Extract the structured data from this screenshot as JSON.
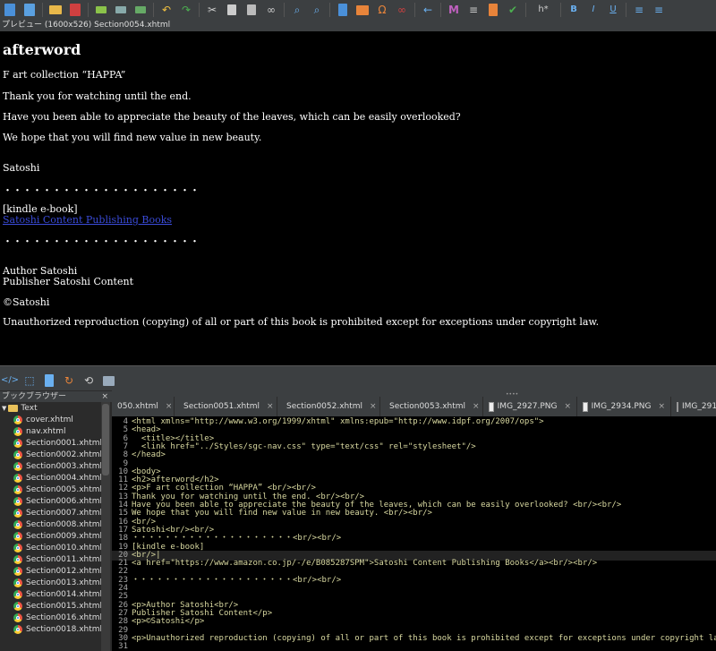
{
  "toolbar": {
    "icons": [
      "new-book-icon",
      "new-file-icon",
      "open-icon",
      "save-icon",
      "add-file-icon",
      "add-existing-icon",
      "import-icon",
      "undo-icon",
      "redo-icon",
      "cut-icon",
      "copy-icon",
      "paste-icon",
      "link-icon",
      "find-icon",
      "find-replace-icon",
      "metadata-icon",
      "image-icon",
      "special-char-icon",
      "link-toggle-icon",
      "previous-icon",
      "spell-icon",
      "list-icon",
      "bookmark-icon",
      "validate-icon",
      "heading-icon",
      "bold-icon",
      "italic-icon",
      "underline-icon",
      "bullet-list-icon",
      "numbered-list-icon"
    ],
    "heading_label": "h*",
    "bold_label": "B",
    "italic_label": "I",
    "underline_label": "U"
  },
  "preview": {
    "title": "プレビュー (1600x526) Section0054.xhtml",
    "heading": "afterword",
    "line1": "F art collection “HAPPA”",
    "line2": "Thank you for watching until the end.",
    "line3": "Have you been able to appreciate the beauty of the leaves, which can be easily overlooked?",
    "line4": "We hope that you will find new value in new beauty.",
    "line5": "Satoshi",
    "dots1": "・・・・・・・・・・・・・・・・・・・・",
    "kindle": "[kindle e-book]",
    "link": "Satoshi Content Publishing Books",
    "dots2": "・・・・・・・・・・・・・・・・・・・・",
    "author": "Author Satoshi",
    "publisher": "Publisher Satoshi Content",
    "copyright": "©Satoshi",
    "notice": "Unauthorized reproduction (copying) of all or part of this book is prohibited except for exceptions under copyright law."
  },
  "book_browser": {
    "title": "ブックブラウザー",
    "close": "×",
    "folder": "Text",
    "files": [
      "cover.xhtml",
      "nav.xhtml",
      "Section0001.xhtml",
      "Section0002.xhtml",
      "Section0003.xhtml",
      "Section0004.xhtml",
      "Section0005.xhtml",
      "Section0006.xhtml",
      "Section0007.xhtml",
      "Section0008.xhtml",
      "Section0009.xhtml",
      "Section0010.xhtml",
      "Section0011.xhtml",
      "Section0012.xhtml",
      "Section0013.xhtml",
      "Section0014.xhtml",
      "Section0015.xhtml",
      "Section0016.xhtml",
      "Section0018.xhtml"
    ]
  },
  "tabs": [
    {
      "label": "050.xhtml",
      "type": "xhtml"
    },
    {
      "label": "Section0051.xhtml",
      "type": "xhtml"
    },
    {
      "label": "Section0052.xhtml",
      "type": "xhtml"
    },
    {
      "label": "Section0053.xhtml",
      "type": "xhtml"
    },
    {
      "label": "IMG_2927.PNG",
      "type": "image"
    },
    {
      "label": "IMG_2934.PNG",
      "type": "image"
    },
    {
      "label": "IMG_2912.PN",
      "type": "image"
    }
  ],
  "tab_close": "×",
  "code": [
    {
      "n": "4",
      "t": "<html xmlns=\"http://www.w3.org/1999/xhtml\" xmlns:epub=\"http://www.idpf.org/2007/ops\">"
    },
    {
      "n": "5",
      "t": "<head>"
    },
    {
      "n": "6",
      "t": "  <title></title>"
    },
    {
      "n": "7",
      "t": "  <link href=\"../Styles/sgc-nav.css\" type=\"text/css\" rel=\"stylesheet\"/>"
    },
    {
      "n": "8",
      "t": "</head>"
    },
    {
      "n": "9",
      "t": ""
    },
    {
      "n": "10",
      "t": "<body>"
    },
    {
      "n": "11",
      "t": "<h2>afterword</h2>"
    },
    {
      "n": "12",
      "t": "<p>F art collection “HAPPA” <br/><br/>"
    },
    {
      "n": "13",
      "t": "Thank you for watching until the end. <br/><br/>"
    },
    {
      "n": "14",
      "t": "Have you been able to appreciate the beauty of the leaves, which can be easily overlooked? <br/><br/>"
    },
    {
      "n": "15",
      "t": "We hope that you will find new value in new beauty. <br/><br/>"
    },
    {
      "n": "16",
      "t": "<br/>"
    },
    {
      "n": "17",
      "t": "Satoshi<br/><br/>"
    },
    {
      "n": "18",
      "t": "・・・・・・・・・・・・・・・・・・・・<br/><br/>"
    },
    {
      "n": "19",
      "t": "[kindle e-book]"
    },
    {
      "n": "20",
      "t": "<br/>|"
    },
    {
      "n": "21",
      "t": "<a href=\"https://www.amazon.co.jp/-/e/B085287SPM\">Satoshi Content Publishing Books</a><br/><br/>"
    },
    {
      "n": "22",
      "t": ""
    },
    {
      "n": "23",
      "t": "・・・・・・・・・・・・・・・・・・・・<br/><br/>"
    },
    {
      "n": "24",
      "t": ""
    },
    {
      "n": "25",
      "t": ""
    },
    {
      "n": "26",
      "t": "<p>Author Satoshi<br/>"
    },
    {
      "n": "27",
      "t": "Publisher Satoshi Content</p>"
    },
    {
      "n": "28",
      "t": "<p>©Satoshi</p>"
    },
    {
      "n": "29",
      "t": ""
    },
    {
      "n": "30",
      "t": "<p>Unauthorized reproduction (copying) of all or part of this book is prohibited except for exceptions under copyright law.</p>"
    },
    {
      "n": "31",
      "t": ""
    }
  ]
}
